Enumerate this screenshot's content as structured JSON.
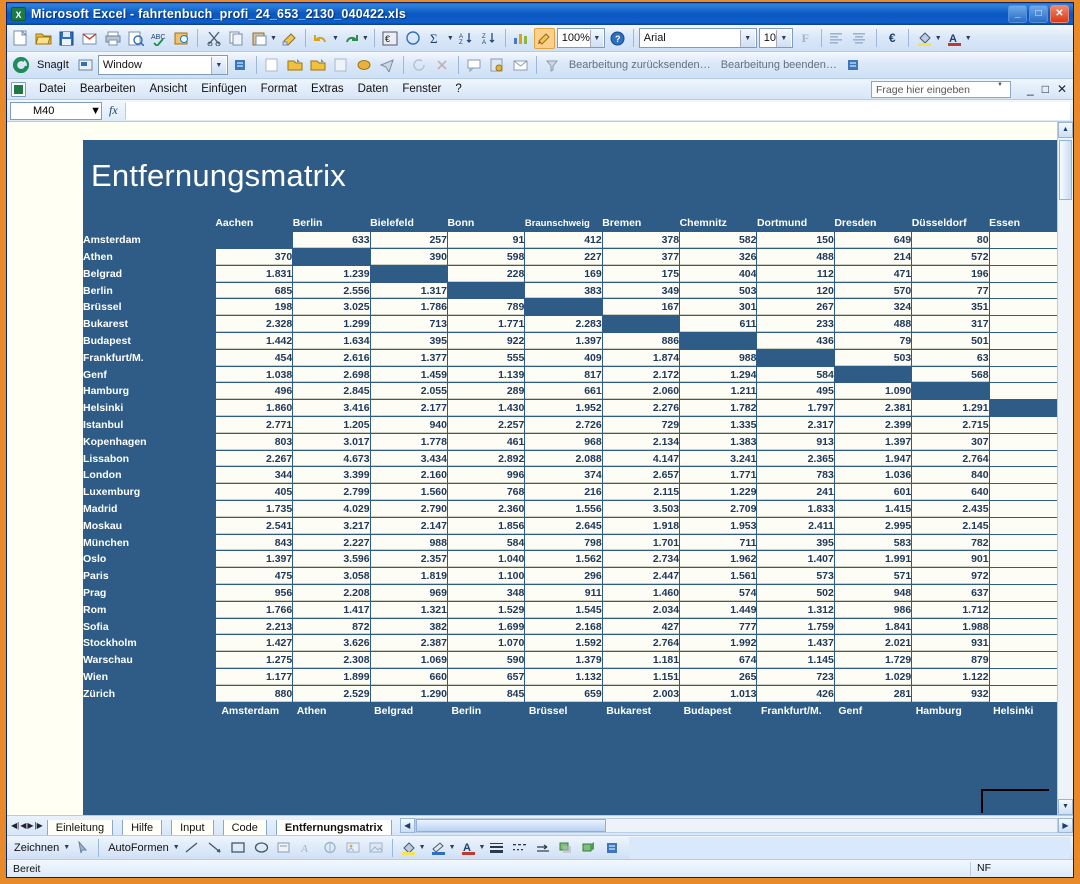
{
  "window": {
    "title": "Microsoft Excel - fahrtenbuch_profi_24_653_2130_040422.xls",
    "app_icon": "excel-icon",
    "minimize_label": "_",
    "maximize_label": "□",
    "close_label": "✕"
  },
  "menubar": {
    "items": [
      "Datei",
      "Bearbeiten",
      "Ansicht",
      "Einfügen",
      "Format",
      "Extras",
      "Daten",
      "Fenster",
      "?"
    ],
    "ask_placeholder": "Frage hier eingeben",
    "doc_minimize": "_",
    "doc_restore": "□",
    "doc_close": "✕"
  },
  "toolbar": {
    "zoom_value": "100%",
    "font_name": "Arial",
    "font_size": "10",
    "bold_label": "F",
    "currency_label": "€"
  },
  "snagit_bar": {
    "label": "SnagIt",
    "mode": "Window"
  },
  "review_bar": {
    "send_back_label": "Bearbeitung zurücksenden…",
    "finish_label": "Bearbeitung beenden…"
  },
  "formula_bar": {
    "name_box": "M40",
    "fx_label": "fx",
    "formula_value": ""
  },
  "sheet_tabs": {
    "items": [
      "Einleitung",
      "Hilfe",
      "Input",
      "Code",
      "Entfernungsmatrix"
    ],
    "active": "Entfernungsmatrix"
  },
  "drawing_bar": {
    "draw_label": "Zeichnen",
    "autoshapes_label": "AutoFormen"
  },
  "statusbar": {
    "text": "Bereit",
    "nf": "NF"
  },
  "chart_data": {
    "type": "table",
    "title": "Entfernungsmatrix",
    "columns": [
      "Aachen",
      "Berlin",
      "Bielefeld",
      "Bonn",
      "Braunschweig",
      "Bremen",
      "Chemnitz",
      "Dortmund",
      "Dresden",
      "Düsseldorf",
      "Essen"
    ],
    "footer_columns": [
      "Amsterdam",
      "Athen",
      "Belgrad",
      "Berlin",
      "Brüssel",
      "Bukarest",
      "Budapest",
      "Frankfurt/M.",
      "Genf",
      "Hamburg",
      "Helsinki"
    ],
    "rows": [
      {
        "label": "Amsterdam",
        "values": [
          "",
          "633",
          "257",
          "91",
          "412",
          "378",
          "582",
          "150",
          "649",
          "80",
          ""
        ],
        "diag": 0
      },
      {
        "label": "Athen",
        "values": [
          "370",
          "",
          "390",
          "598",
          "227",
          "377",
          "326",
          "488",
          "214",
          "572",
          ""
        ],
        "diag": 1
      },
      {
        "label": "Belgrad",
        "values": [
          "1.831",
          "1.239",
          "",
          "228",
          "169",
          "175",
          "404",
          "112",
          "471",
          "196",
          ""
        ],
        "diag": 2
      },
      {
        "label": "Berlin",
        "values": [
          "685",
          "2.556",
          "1.317",
          "",
          "383",
          "349",
          "503",
          "120",
          "570",
          "77",
          ""
        ],
        "diag": 3
      },
      {
        "label": "Brüssel",
        "values": [
          "198",
          "3.025",
          "1.786",
          "789",
          "",
          "167",
          "301",
          "267",
          "324",
          "351",
          ""
        ],
        "diag": 4
      },
      {
        "label": "Bukarest",
        "values": [
          "2.328",
          "1.299",
          "713",
          "1.771",
          "2.283",
          "",
          "611",
          "233",
          "488",
          "317",
          ""
        ],
        "diag": 5
      },
      {
        "label": "Budapest",
        "values": [
          "1.442",
          "1.634",
          "395",
          "922",
          "1.397",
          "886",
          "",
          "436",
          "79",
          "501",
          ""
        ],
        "diag": 6
      },
      {
        "label": "Frankfurt/M.",
        "values": [
          "454",
          "2.616",
          "1.377",
          "555",
          "409",
          "1.874",
          "988",
          "",
          "503",
          "63",
          ""
        ],
        "diag": 7
      },
      {
        "label": "Genf",
        "values": [
          "1.038",
          "2.698",
          "1.459",
          "1.139",
          "817",
          "2.172",
          "1.294",
          "584",
          "",
          "568",
          ""
        ],
        "diag": 8
      },
      {
        "label": "Hamburg",
        "values": [
          "496",
          "2.845",
          "2.055",
          "289",
          "661",
          "2.060",
          "1.211",
          "495",
          "1.090",
          "",
          ""
        ],
        "diag": 9
      },
      {
        "label": "Helsinki",
        "values": [
          "1.860",
          "3.416",
          "2.177",
          "1.430",
          "1.952",
          "2.276",
          "1.782",
          "1.797",
          "2.381",
          "1.291",
          ""
        ],
        "diag": 10
      },
      {
        "label": "Istanbul",
        "values": [
          "2.771",
          "1.205",
          "940",
          "2.257",
          "2.726",
          "729",
          "1.335",
          "2.317",
          "2.399",
          "2.715",
          ""
        ],
        "diag": -1
      },
      {
        "label": "Kopenhagen",
        "values": [
          "803",
          "3.017",
          "1.778",
          "461",
          "968",
          "2.134",
          "1.383",
          "913",
          "1.397",
          "307",
          ""
        ],
        "diag": -1
      },
      {
        "label": "Lissabon",
        "values": [
          "2.267",
          "4.673",
          "3.434",
          "2.892",
          "2.088",
          "4.147",
          "3.241",
          "2.365",
          "1.947",
          "2.764",
          ""
        ],
        "diag": -1
      },
      {
        "label": "London",
        "values": [
          "344",
          "3.399",
          "2.160",
          "996",
          "374",
          "2.657",
          "1.771",
          "783",
          "1.036",
          "840",
          ""
        ],
        "diag": -1
      },
      {
        "label": "Luxemburg",
        "values": [
          "405",
          "2.799",
          "1.560",
          "768",
          "216",
          "2.115",
          "1.229",
          "241",
          "601",
          "640",
          ""
        ],
        "diag": -1
      },
      {
        "label": "Madrid",
        "values": [
          "1.735",
          "4.029",
          "2.790",
          "2.360",
          "1.556",
          "3.503",
          "2.709",
          "1.833",
          "1.415",
          "2.435",
          ""
        ],
        "diag": -1
      },
      {
        "label": "Moskau",
        "values": [
          "2.541",
          "3.217",
          "2.147",
          "1.856",
          "2.645",
          "1.918",
          "1.953",
          "2.411",
          "2.995",
          "2.145",
          ""
        ],
        "diag": -1
      },
      {
        "label": "München",
        "values": [
          "843",
          "2.227",
          "988",
          "584",
          "798",
          "1.701",
          "711",
          "395",
          "583",
          "782",
          ""
        ],
        "diag": -1
      },
      {
        "label": "Oslo",
        "values": [
          "1.397",
          "3.596",
          "2.357",
          "1.040",
          "1.562",
          "2.734",
          "1.962",
          "1.407",
          "1.991",
          "901",
          ""
        ],
        "diag": -1
      },
      {
        "label": "Paris",
        "values": [
          "475",
          "3.058",
          "1.819",
          "1.100",
          "296",
          "2.447",
          "1.561",
          "573",
          "571",
          "972",
          ""
        ],
        "diag": -1
      },
      {
        "label": "Prag",
        "values": [
          "956",
          "2.208",
          "969",
          "348",
          "911",
          "1.460",
          "574",
          "502",
          "948",
          "637",
          ""
        ],
        "diag": -1
      },
      {
        "label": "Rom",
        "values": [
          "1.766",
          "1.417",
          "1.321",
          "1.529",
          "1.545",
          "2.034",
          "1.449",
          "1.312",
          "986",
          "1.712",
          ""
        ],
        "diag": -1
      },
      {
        "label": "Sofia",
        "values": [
          "2.213",
          "872",
          "382",
          "1.699",
          "2.168",
          "427",
          "777",
          "1.759",
          "1.841",
          "1.988",
          ""
        ],
        "diag": -1
      },
      {
        "label": "Stockholm",
        "values": [
          "1.427",
          "3.626",
          "2.387",
          "1.070",
          "1.592",
          "2.764",
          "1.992",
          "1.437",
          "2.021",
          "931",
          ""
        ],
        "diag": -1
      },
      {
        "label": "Warschau",
        "values": [
          "1.275",
          "2.308",
          "1.069",
          "590",
          "1.379",
          "1.181",
          "674",
          "1.145",
          "1.729",
          "879",
          ""
        ],
        "diag": -1
      },
      {
        "label": "Wien",
        "values": [
          "1.177",
          "1.899",
          "660",
          "657",
          "1.132",
          "1.151",
          "265",
          "723",
          "1.029",
          "1.122",
          ""
        ],
        "diag": -1
      },
      {
        "label": "Zürich",
        "values": [
          "880",
          "2.529",
          "1.290",
          "845",
          "659",
          "2.003",
          "1.013",
          "426",
          "281",
          "932",
          ""
        ],
        "diag": -1
      }
    ]
  }
}
